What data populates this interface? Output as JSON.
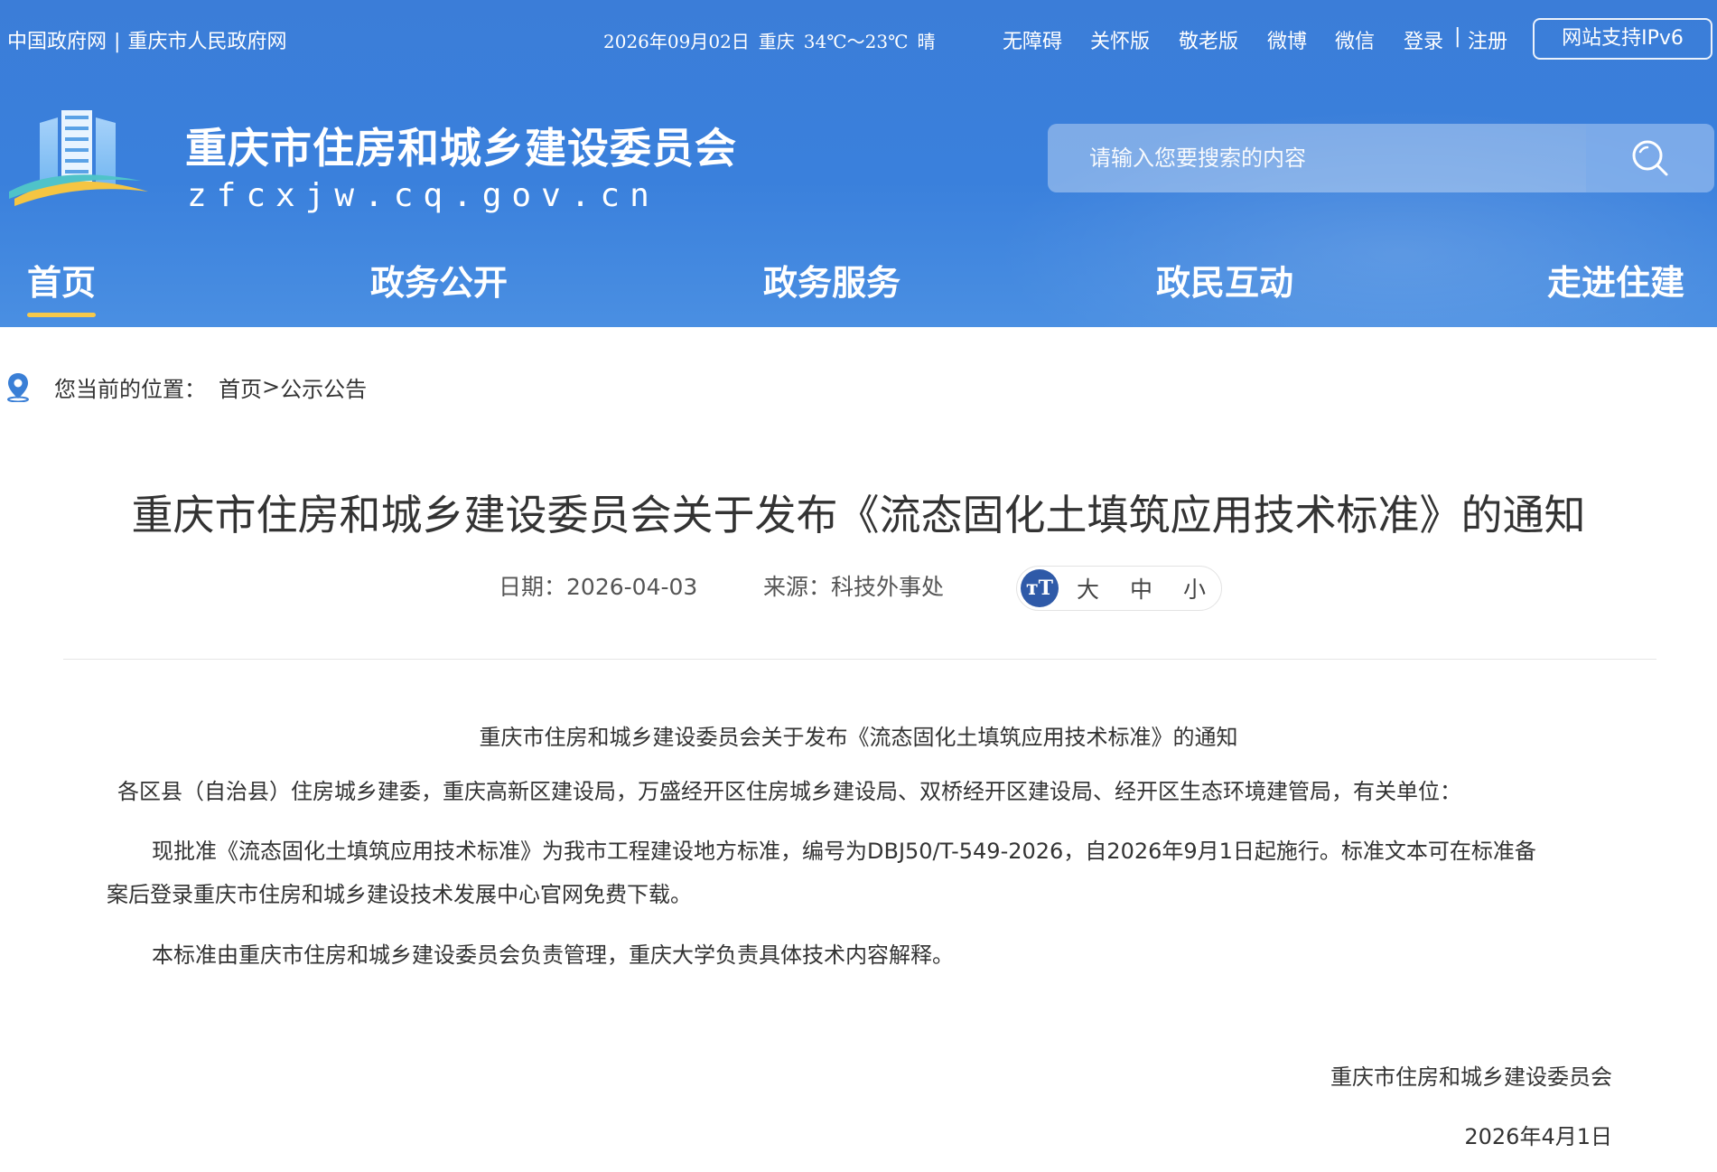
{
  "topbar": {
    "gov_links": [
      "中国政府网",
      "重庆市人民政府网"
    ],
    "date": "2026年09月02日",
    "city": "重庆",
    "temperature": "34℃～23℃",
    "weather": "晴",
    "accessibility": "无障碍",
    "care_mode": "关怀版",
    "elder_mode": "敬老版",
    "weibo": "微博",
    "wechat": "微信",
    "login": "登录",
    "register": "注册",
    "ipv6": "网站支持IPv6"
  },
  "site": {
    "title": "重庆市住房和城乡建设委员会",
    "domain": "zfcxjw.cq.gov.cn"
  },
  "search": {
    "placeholder": "请输入您要搜索的内容",
    "icon": "search-icon"
  },
  "nav": {
    "items": [
      {
        "label": "首页",
        "active": true
      },
      {
        "label": "政务公开"
      },
      {
        "label": "政务服务"
      },
      {
        "label": "政民互动"
      },
      {
        "label": "走进住建"
      }
    ]
  },
  "breadcrumb": {
    "prefix": "您当前的位置：",
    "home": "首页",
    "separator": ">",
    "current": "公示公告"
  },
  "article": {
    "title": "重庆市住房和城乡建设委员会关于发布《流态固化土填筑应用技术标准》的通知",
    "date_label": "日期：",
    "date": "2026-04-03",
    "source_label": "来源：",
    "source": "科技外事处",
    "font_sizes": [
      "大",
      "中",
      "小"
    ],
    "heading": "重庆市住房和城乡建设委员会关于发布《流态固化土填筑应用技术标准》的通知",
    "salutation": "各区县（自治县）住房城乡建委，重庆高新区建设局，万盛经开区住房城乡建设局、双桥经开区建设局、经开区生态环境建管局，有关单位：",
    "para1_line1": "现批准《流态固化土填筑应用技术标准》为我市工程建设地方标准，编号为DBJ50/T-549-2026，自2026年9月1日起施行。标准文本可在标准备",
    "para1_line2": "案后登录重庆市住房和城乡建设技术发展中心官网免费下载。",
    "para2": "本标准由重庆市住房和城乡建设委员会负责管理，重庆大学负责具体技术内容解释。",
    "sign_org": "重庆市住房和城乡建设委员会",
    "sign_date": "2026年4月1日"
  }
}
